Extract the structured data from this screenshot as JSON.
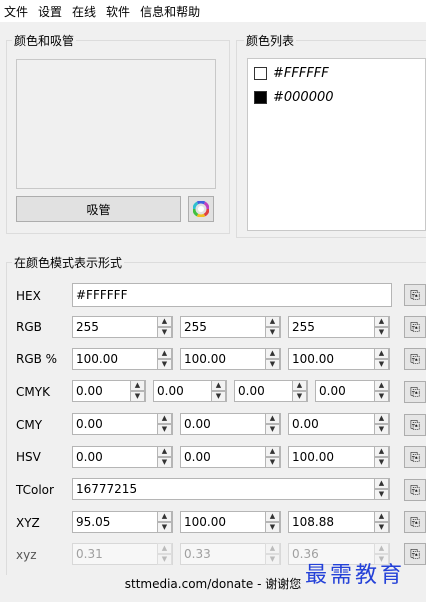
{
  "menu": [
    "文件",
    "设置",
    "在线",
    "软件",
    "信息和帮助"
  ],
  "picker": {
    "title": "颜色和吸管",
    "eyedropper_label": "吸管"
  },
  "color_list": {
    "title": "颜色列表",
    "items": [
      {
        "hex": "#FFFFFF",
        "swatch": "#ffffff"
      },
      {
        "hex": "#000000",
        "swatch": "#000000"
      }
    ]
  },
  "models": {
    "title": "在颜色模式表示形式",
    "hex": {
      "label": "HEX",
      "value": "#FFFFFF"
    },
    "rgb": {
      "label": "RGB",
      "values": [
        "255",
        "255",
        "255"
      ]
    },
    "rgbp": {
      "label": "RGB %",
      "values": [
        "100.00",
        "100.00",
        "100.00"
      ]
    },
    "cmyk": {
      "label": "CMYK",
      "values": [
        "0.00",
        "0.00",
        "0.00",
        "0.00"
      ]
    },
    "cmy": {
      "label": "CMY",
      "values": [
        "0.00",
        "0.00",
        "0.00"
      ]
    },
    "hsv": {
      "label": "HSV",
      "values": [
        "0.00",
        "0.00",
        "100.00"
      ]
    },
    "tcolor": {
      "label": "TColor",
      "value": "16777215"
    },
    "xyz": {
      "label": "XYZ",
      "values": [
        "95.05",
        "100.00",
        "108.88"
      ]
    },
    "xyz_lower": {
      "label": "xyz",
      "values": [
        "0.31",
        "0.33",
        "0.36"
      ]
    }
  },
  "footer": "sttmedia.com/donate - 谢谢您",
  "watermark": "最需教育"
}
